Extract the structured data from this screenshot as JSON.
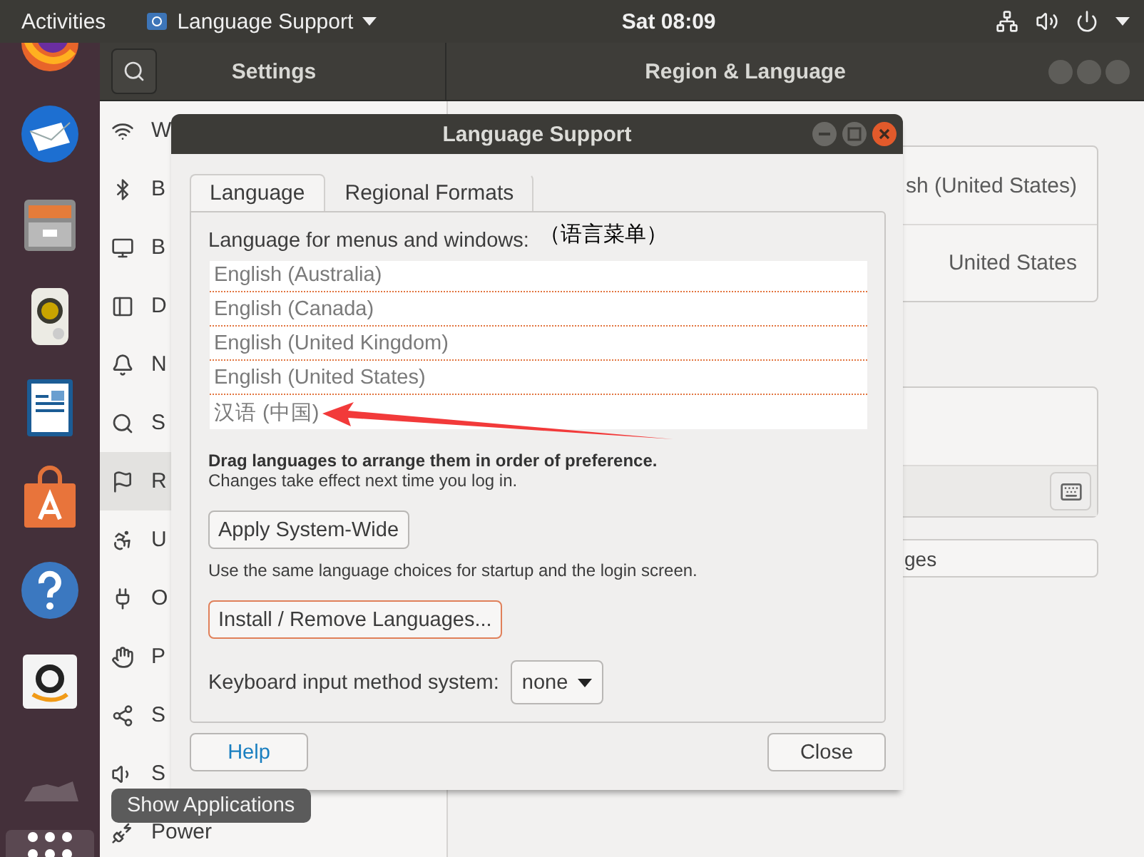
{
  "top_bar": {
    "activities": "Activities",
    "app_menu": "Language Support",
    "clock": "Sat 08:09"
  },
  "settings": {
    "title": "Settings",
    "panel_title": "Region & Language",
    "sidebar": [
      {
        "label": "W",
        "selected": false
      },
      {
        "label": "B",
        "selected": false
      },
      {
        "label": "B",
        "selected": false
      },
      {
        "label": "D",
        "selected": false
      },
      {
        "label": "N",
        "selected": false
      },
      {
        "label": "S",
        "selected": false
      },
      {
        "label": "R",
        "selected": true
      },
      {
        "label": "U",
        "selected": false
      },
      {
        "label": "O",
        "selected": false
      },
      {
        "label": "P",
        "selected": false
      },
      {
        "label": "S",
        "selected": false
      },
      {
        "label": "S",
        "selected": false
      },
      {
        "label": "Power",
        "selected": false
      }
    ],
    "language_value": "sh (United States)",
    "formats_value": "United States",
    "manage_button": "ges"
  },
  "dialog": {
    "title": "Language Support",
    "tabs": [
      {
        "label": "Language",
        "selected": true
      },
      {
        "label": "Regional Formats",
        "selected": false
      }
    ],
    "list_label": "Language for menus and windows:",
    "languages": [
      "English (Australia)",
      "English (Canada)",
      "English (United Kingdom)",
      "English (United States)",
      "汉语 (中国)"
    ],
    "drag_hint": "Drag languages to arrange them in order of preference.",
    "drag_note": "Changes take effect next time you log in.",
    "apply_button": "Apply System-Wide",
    "apply_note": "Use the same language choices for startup and the login screen.",
    "install_button": {
      "label": "Install / Remove Languages...",
      "focused": true
    },
    "input_method_label": "Keyboard input method system:",
    "input_method_value": "none",
    "help_button": "Help",
    "close_button": "Close"
  },
  "annotation": {
    "text": "（语言菜单）"
  },
  "tooltip": "Show Applications"
}
